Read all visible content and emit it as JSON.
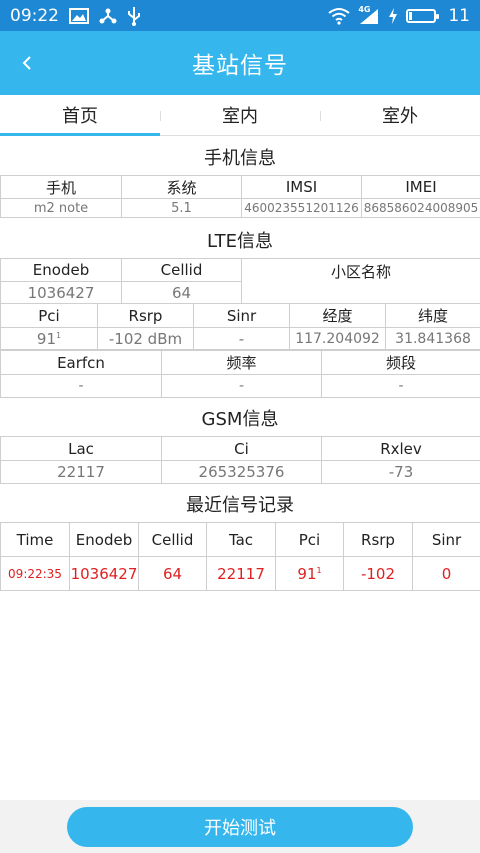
{
  "status": {
    "time": "09:22",
    "battery_percent": "11",
    "battery_level": 0.11,
    "network_label": "4G"
  },
  "header": {
    "title": "基站信号"
  },
  "tabs": [
    {
      "label": "首页"
    },
    {
      "label": "室内"
    },
    {
      "label": "室外"
    }
  ],
  "phone_info": {
    "title": "手机信息",
    "headers": [
      "手机",
      "系统",
      "IMSI",
      "IMEI"
    ],
    "values": [
      "m2 note",
      "5.1",
      "460023551201126",
      "868586024008905"
    ]
  },
  "lte_info": {
    "title": "LTE信息",
    "row1_headers": [
      "Enodeb",
      "Cellid",
      "小区名称"
    ],
    "row1_values": [
      "1036427",
      "64",
      ""
    ],
    "row2_headers": [
      "Pci",
      "Rsrp",
      "Sinr",
      "经度",
      "纬度"
    ],
    "row2_values": [
      "91",
      "-102 dBm",
      "-",
      "117.204092",
      "31.841368"
    ],
    "pci_sup": "1",
    "row3_headers": [
      "Earfcn",
      "频率",
      "频段"
    ],
    "row3_values": [
      "-",
      "-",
      "-"
    ]
  },
  "gsm_info": {
    "title": "GSM信息",
    "headers": [
      "Lac",
      "Ci",
      "Rxlev"
    ],
    "values": [
      "22117",
      "265325376",
      "-73"
    ]
  },
  "recent_records": {
    "title": "最近信号记录",
    "headers": [
      "Time",
      "Enodeb",
      "Cellid",
      "Tac",
      "Pci",
      "Rsrp",
      "Sinr"
    ],
    "rows": [
      [
        "09:22:35",
        "1036427",
        "64",
        "22117",
        "91",
        "-102",
        "0"
      ]
    ],
    "pci_sup": "1"
  },
  "actions": {
    "start_label": "开始测试"
  },
  "colors": {
    "status_bar": "#1e88d4",
    "app_bar": "#35b6ec",
    "accent": "#35b6ec",
    "record_text": "#e02020"
  }
}
